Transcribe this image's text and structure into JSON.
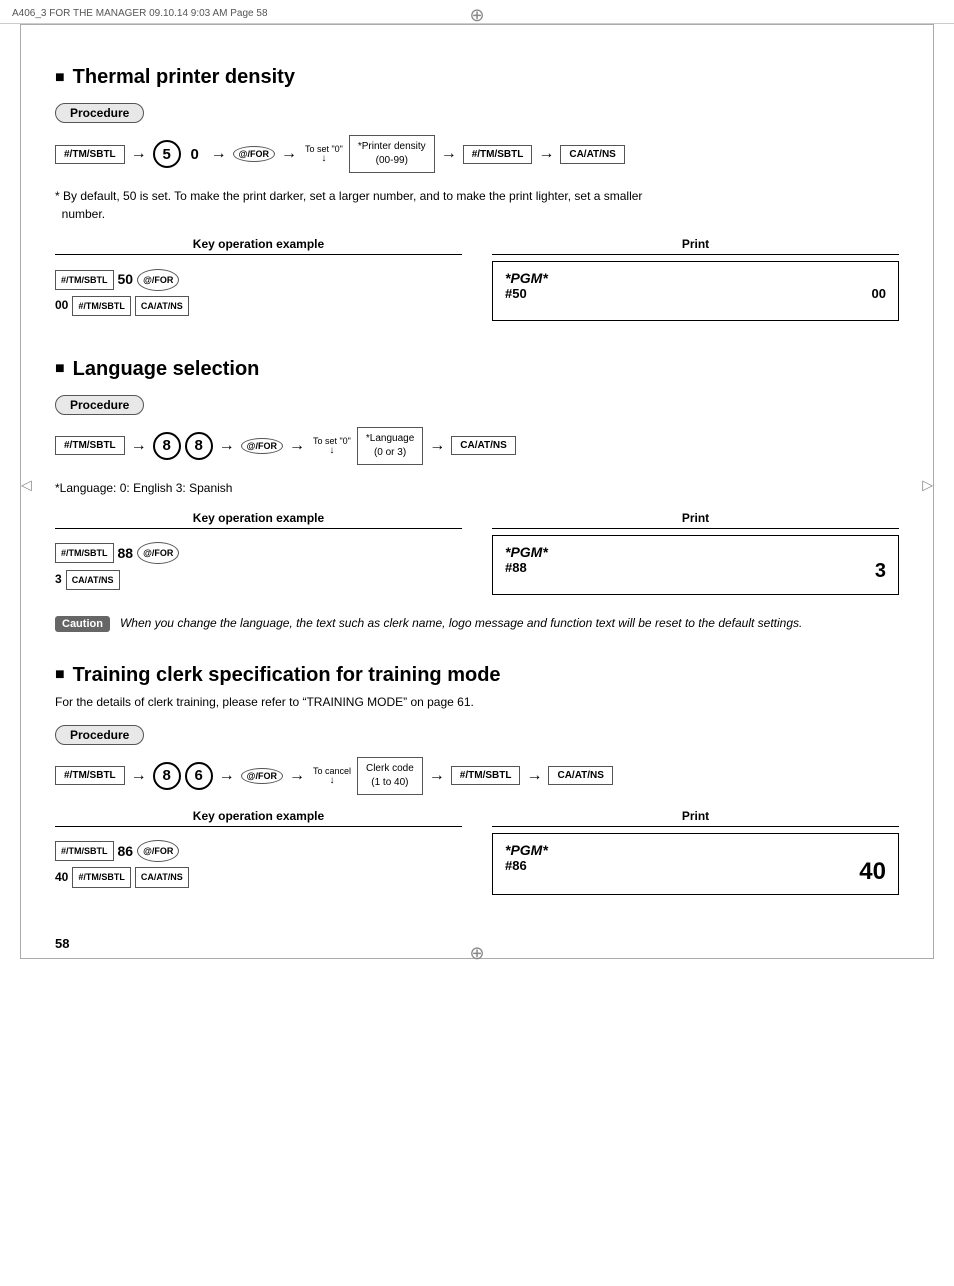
{
  "header": {
    "left": "A406_3 FOR THE MANAGER  09.10.14 9:03 AM  Page 58"
  },
  "page_number": "58",
  "section1": {
    "title": "Thermal printer density",
    "procedure_label": "Procedure",
    "to_set_label": "To set \"0\"",
    "keys": [
      "#/TM/SBTL",
      "5",
      "0",
      "@/FOR",
      "*Printer density\n(00-99)",
      "#/TM/SBTL",
      "CA/AT/NS"
    ],
    "note": "* By default, 50 is set.  To make the print darker, set a larger number, and to make the print lighter, set a smaller\n  number.",
    "key_op_header": "Key operation example",
    "print_header": "Print",
    "key_op_lines": [
      "#/TM/SBTL  50  @/FOR",
      "00  #/TM/SBTL  CA/AT/NS"
    ],
    "print_line1": "*PGM*",
    "print_line2_left": "#50",
    "print_line2_right": "00"
  },
  "section2": {
    "title": "Language selection",
    "procedure_label": "Procedure",
    "to_set_label": "To set \"0\"",
    "keys": [
      "#/TM/SBTL",
      "8",
      "8",
      "@/FOR",
      "*Language\n(0 or 3)",
      "CA/AT/NS"
    ],
    "note": "*Language: 0: English    3: Spanish",
    "key_op_header": "Key operation example",
    "print_header": "Print",
    "key_op_lines": [
      "#/TM/SBTL  88  @/FOR",
      "3  CA/AT/NS"
    ],
    "print_line1": "*PGM*",
    "print_line2_left": "#88",
    "print_line2_right": "3",
    "caution_label": "Caution",
    "caution_text": "When you change the language, the text such as clerk name, logo message and function text will be reset to the default settings."
  },
  "section3": {
    "title": "Training clerk specification for training mode",
    "intro": "For the details of clerk training, please refer to “TRAINING MODE” on page 61.",
    "procedure_label": "Procedure",
    "to_cancel_label": "To cancel",
    "keys": [
      "#/TM/SBTL",
      "8",
      "6",
      "@/FOR",
      "Clerk code\n(1 to 40)",
      "#/TM/SBTL",
      "CA/AT/NS"
    ],
    "key_op_header": "Key operation example",
    "print_header": "Print",
    "key_op_lines": [
      "#/TM/SBTL  86  @/FOR",
      "40  #/TM/SBTL  CA/AT/NS"
    ],
    "print_line1": "*PGM*",
    "print_line2_left": "#86",
    "print_line2_right": "40"
  }
}
